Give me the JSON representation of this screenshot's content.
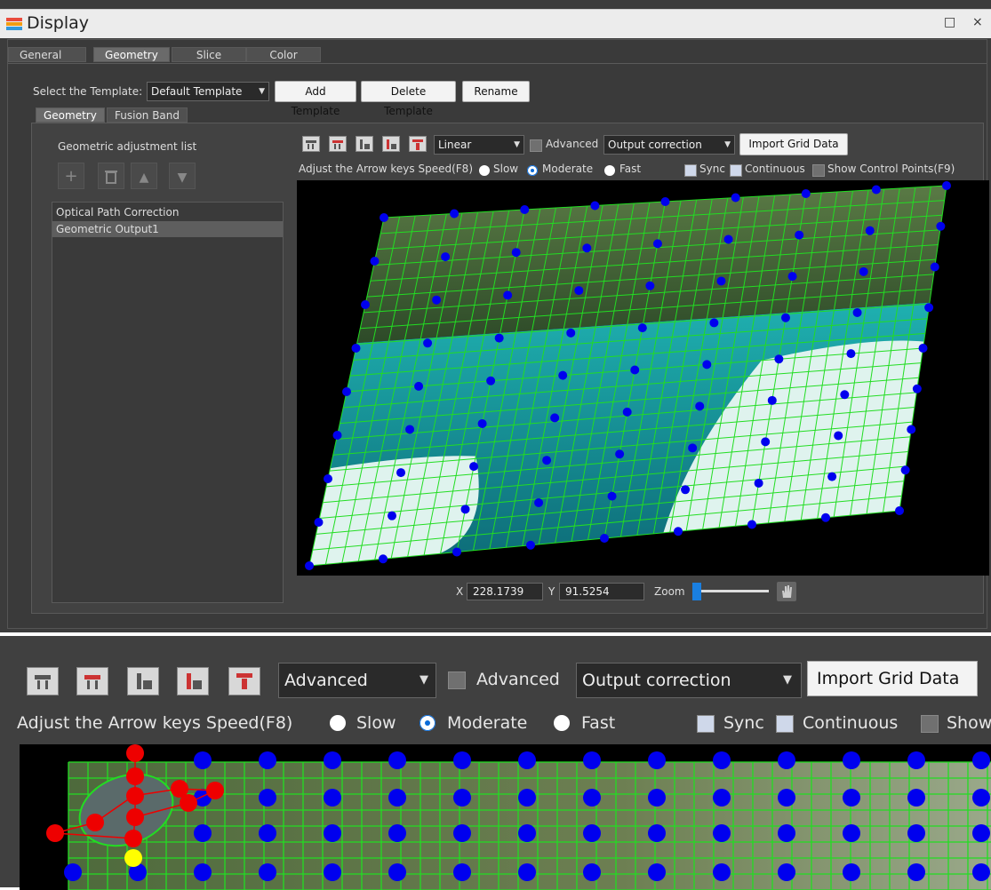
{
  "window": {
    "title": "Display",
    "maximize_glyph": "□",
    "close_glyph": "×"
  },
  "main_tabs": [
    "General",
    "Geometry",
    "Slice",
    "Color"
  ],
  "template": {
    "label": "Select the Template:",
    "selected": "Default Template",
    "add": "Add Template",
    "delete": "Delete Template",
    "rename": "Rename"
  },
  "sub_tabs": [
    "Geometry",
    "Fusion Band"
  ],
  "left_panel": {
    "heading": "Geometric adjustment list",
    "items": [
      "Optical Path Correction",
      "Geometric Output1"
    ]
  },
  "toolbar": {
    "mode": "Linear",
    "advanced_label": "Advanced",
    "correction": "Output correction",
    "import": "Import Grid Data"
  },
  "speed": {
    "label": "Adjust the Arrow keys Speed(F8)",
    "slow": "Slow",
    "moderate": "Moderate",
    "fast": "Fast",
    "selected": "Moderate"
  },
  "options": {
    "sync": "Sync",
    "continuous": "Continuous",
    "show_cp": "Show Control Points(F9)",
    "sync_checked": true,
    "continuous_checked": true,
    "show_cp_checked": false
  },
  "coords": {
    "x_label": "X",
    "x": "228.1739",
    "y_label": "Y",
    "y": "91.5254",
    "zoom_label": "Zoom"
  },
  "zoomed": {
    "mode": "Advanced",
    "advanced_label": "Advanced",
    "correction": "Output correction",
    "import": "Import Grid Data",
    "speed_label": "Adjust the Arrow keys Speed(F8)",
    "slow": "Slow",
    "moderate": "Moderate",
    "fast": "Fast",
    "sync": "Sync",
    "continuous": "Continuous",
    "show_partial": "Show"
  },
  "colors": {
    "grid": "#22dd22",
    "control_point": "#0000ee",
    "selected_point": "#ee0000",
    "active_point": "#ffff00",
    "water": "#1fb0b0"
  },
  "icons": [
    "template-icon-1",
    "template-icon-2",
    "template-icon-3",
    "template-icon-4",
    "template-icon-5",
    "add-icon",
    "trash-icon",
    "up-arrow-icon",
    "down-arrow-icon",
    "hand-icon",
    "window-icon"
  ]
}
